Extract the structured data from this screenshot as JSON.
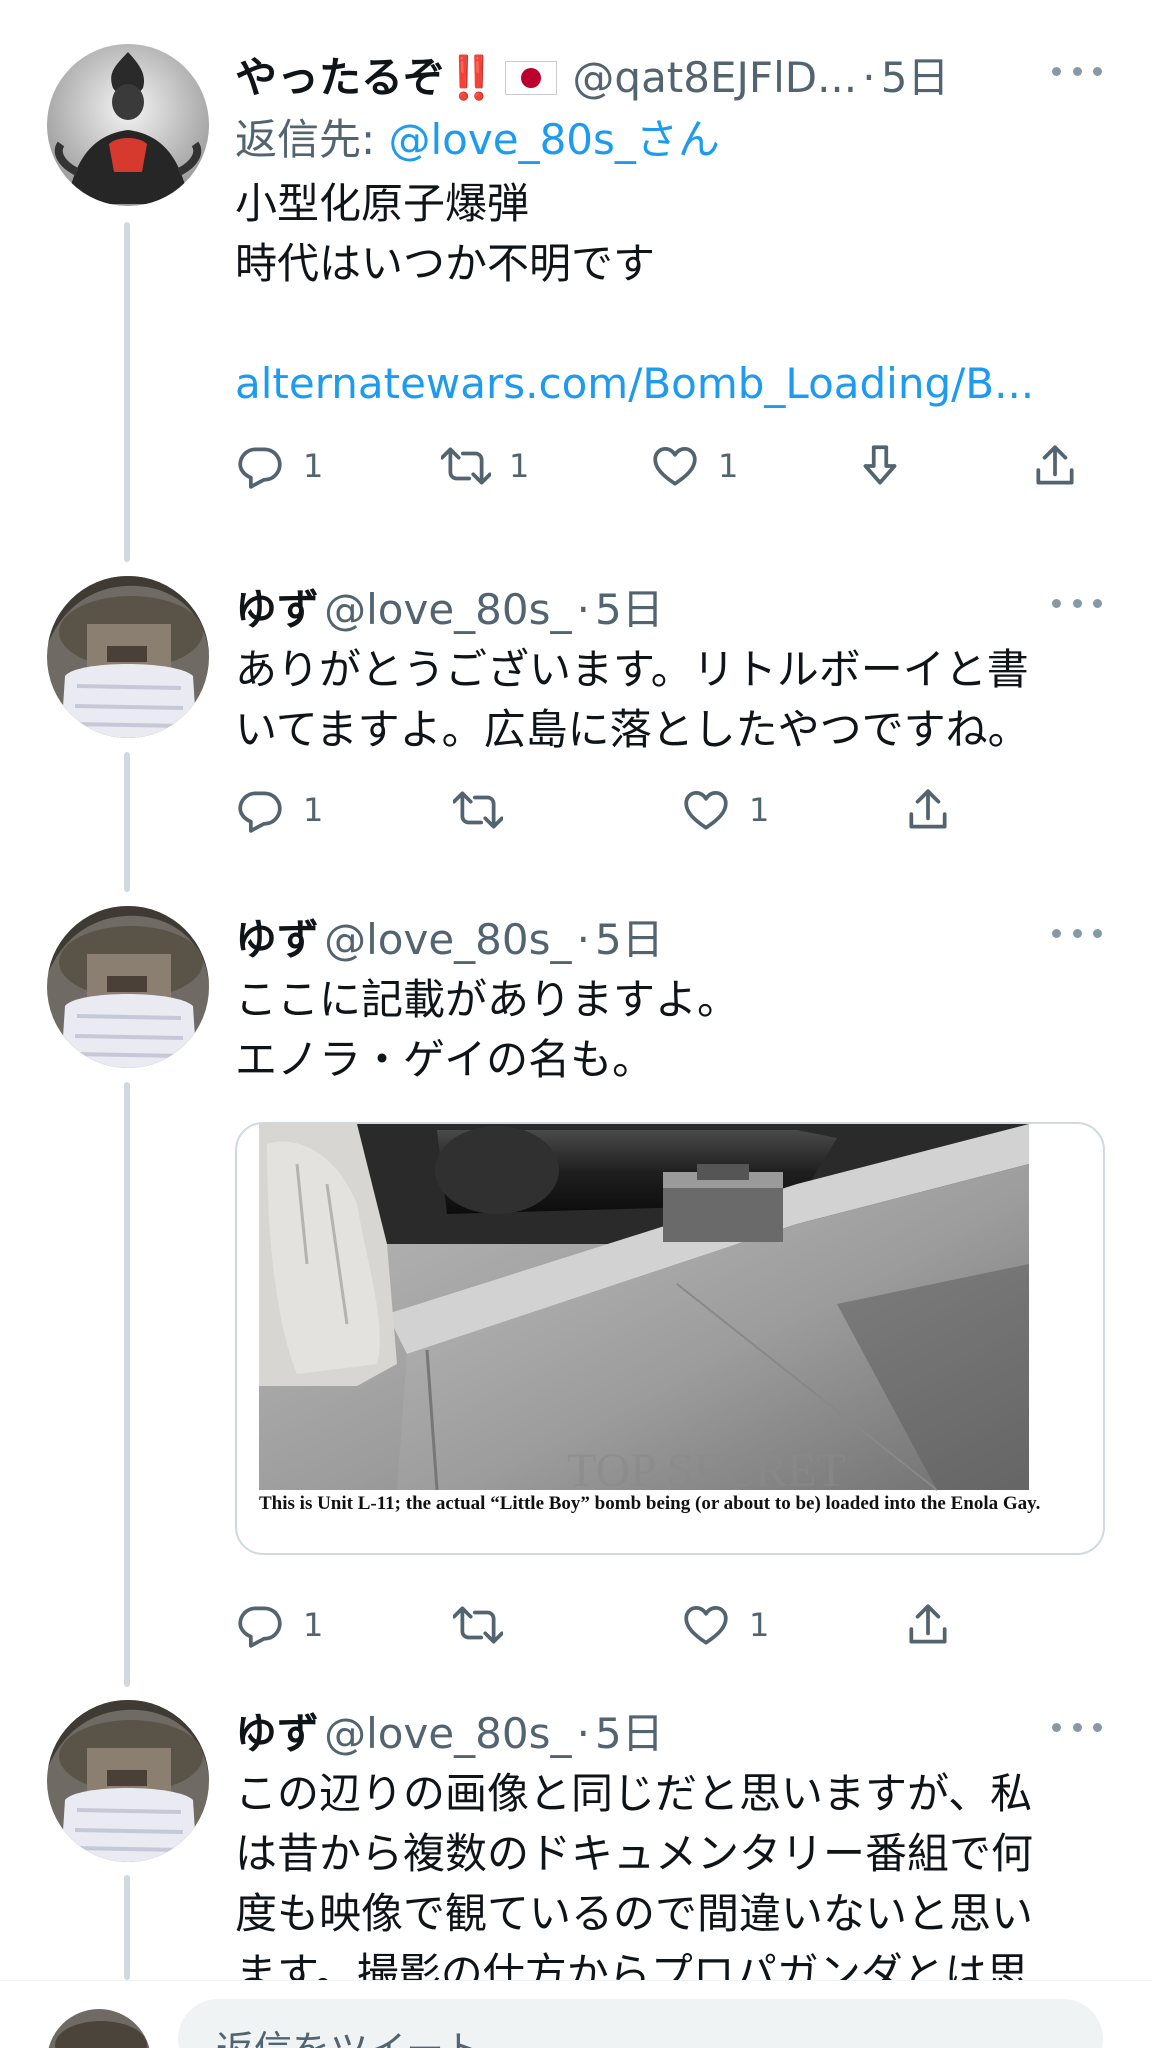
{
  "tweets": [
    {
      "name": "やったるぞ",
      "emoji": "‼️",
      "handle": "@qat8EJFlD...",
      "dot": "·",
      "time": "5日",
      "reply_label": "返信先:",
      "reply_mention": "@love_80s_さん",
      "text_lines": [
        "小型化原子爆弾",
        "時代はいつか不明です"
      ],
      "link": "alternatewars.com/Bomb_Loading/B...",
      "reply_count": "1",
      "retweet_count": "1",
      "like_count": "1"
    },
    {
      "name": "ゆず",
      "handle": "@love_80s_",
      "dot": "·",
      "time": "5日",
      "text_lines": [
        "ありがとうございます。リトルボーイと書",
        "いてますよ。広島に落としたやつですね。"
      ],
      "reply_count": "1",
      "like_count": "1"
    },
    {
      "name": "ゆず",
      "handle": "@love_80s_",
      "dot": "·",
      "time": "5日",
      "text_lines": [
        "ここに記載がありますよ。",
        "エノラ・ゲイの名も。"
      ],
      "media_caption": "This is Unit L-11; the actual “Little Boy” bomb being (or about to be) loaded into the Enola Gay.",
      "media_watermark": "TOP SECRET",
      "reply_count": "1",
      "like_count": "1"
    },
    {
      "name": "ゆず",
      "handle": "@love_80s_",
      "dot": "·",
      "time": "5日",
      "text_lines": [
        "この辺りの画像と同じだと思いますが、私",
        "は昔から複数のドキュメンタリー番組で何",
        "度も映像で観ているので間違いないと思い",
        "ます。撮影の仕方からプロパガンダとは思"
      ]
    }
  ],
  "composer": {
    "placeholder": "返信をツイート"
  },
  "icons": [
    "reply-icon",
    "retweet-icon",
    "like-icon",
    "download-icon",
    "share-icon",
    "more-icon"
  ],
  "colors": {
    "link": "#1d9bf0",
    "secondary": "#536471",
    "thread": "#cfd9de"
  }
}
